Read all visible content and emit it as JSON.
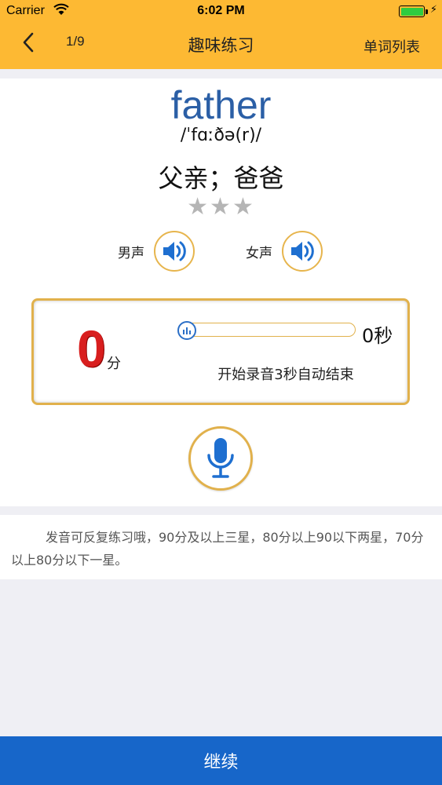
{
  "status_bar": {
    "carrier": "Carrier",
    "time": "6:02 PM",
    "icons": [
      "wifi-icon",
      "battery-icon",
      "charging-bolt-icon"
    ]
  },
  "nav": {
    "counter": "1/9",
    "title": "趣味练习",
    "word_list_label": "单词列表",
    "back_icon": "chevron-left-icon"
  },
  "word": {
    "text": "father",
    "phonetic": "/ˈfɑːðə(r)/",
    "meaning": "父亲；爸爸",
    "stars_total": 3,
    "stars_filled": 0,
    "stars_display": "★★★"
  },
  "voices": {
    "male_label": "男声",
    "female_label": "女声",
    "icon": "speaker-icon"
  },
  "recorder": {
    "score": "0",
    "score_unit": "分",
    "seconds": "0秒",
    "progress_fraction": 0,
    "hint": "开始录音3秒自动结束",
    "mic_icon": "microphone-icon"
  },
  "tip": {
    "text": "发音可反复练习哦，90分及以上三星，80分以上90以下两星，70分以上80分以下一星。"
  },
  "footer": {
    "continue_label": "继续"
  },
  "colors": {
    "header": "#fdb933",
    "accent_blue": "#1766c9",
    "word_blue": "#2b5fa6",
    "score_red": "#d81e1e",
    "gold_border": "#e1b14c",
    "star_gray": "#b5b5b5"
  }
}
